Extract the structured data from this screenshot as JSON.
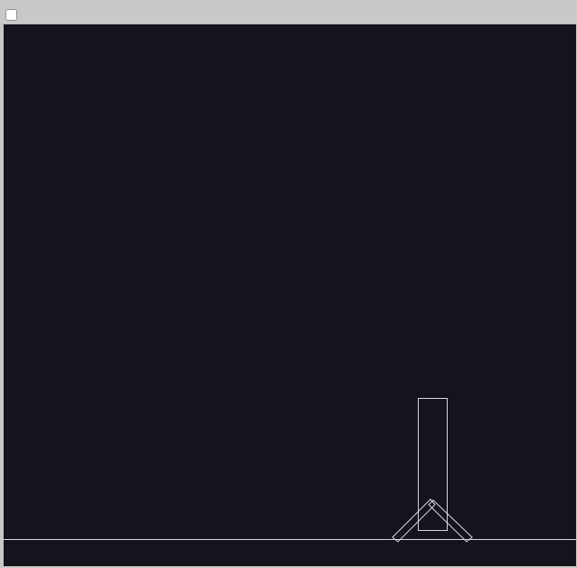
{
  "toolbar": {
    "checkbox_checked": false
  },
  "scene": {
    "background_color": "#14141c",
    "outline_color": "#d8d8de",
    "ground_color": "#d8d8de",
    "objects": [
      {
        "name": "ground-line",
        "type": "line"
      },
      {
        "name": "tall-rectangle",
        "type": "rect"
      },
      {
        "name": "left-leg",
        "type": "rotated-rect"
      },
      {
        "name": "right-leg",
        "type": "rotated-rect"
      }
    ]
  }
}
